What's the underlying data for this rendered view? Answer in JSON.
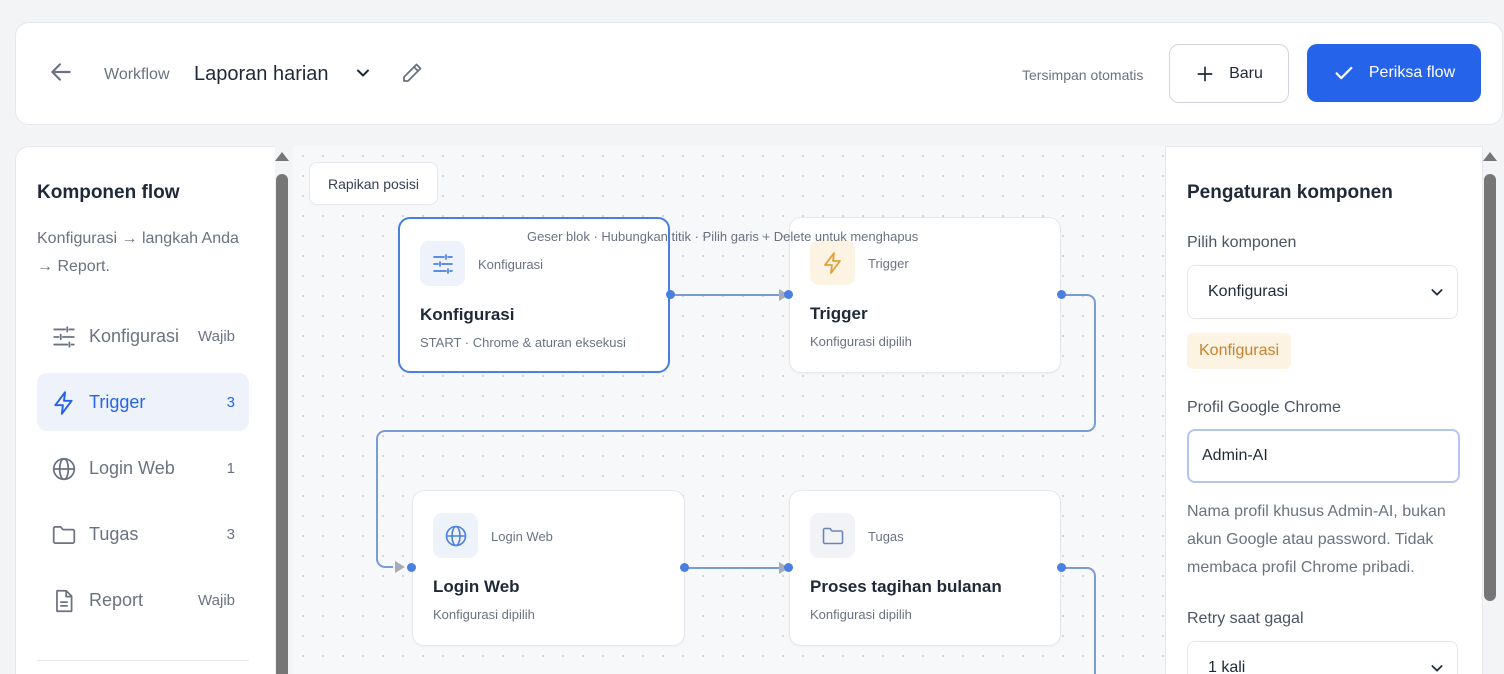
{
  "header": {
    "crumb": "Workflow",
    "title": "Laporan harian",
    "autosave": "Tersimpan otomatis",
    "new_label": "Baru",
    "check_label": "Periksa flow"
  },
  "sidebar": {
    "title": "Komponen flow",
    "description": "Konfigurasi → langkah Anda → Report.",
    "items": [
      {
        "label": "Konfigurasi",
        "badge": "Wajib",
        "icon": "sliders-icon"
      },
      {
        "label": "Trigger",
        "badge": "3",
        "icon": "lightning-icon"
      },
      {
        "label": "Login Web",
        "badge": "1",
        "icon": "globe-icon"
      },
      {
        "label": "Tugas",
        "badge": "3",
        "icon": "folder-icon"
      },
      {
        "label": "Report",
        "badge": "Wajib",
        "icon": "document-icon"
      }
    ]
  },
  "canvas": {
    "tidy_label": "Rapikan posisi",
    "hint": "Geser blok · Hubungkan titik · Pilih garis + Delete untuk menghapus",
    "nodes": [
      {
        "tag": "Konfigurasi",
        "name": "Konfigurasi",
        "sub": "START · Chrome & aturan eksekusi"
      },
      {
        "tag": "Trigger",
        "name": "Trigger",
        "sub": "Konfigurasi dipilih"
      },
      {
        "tag": "Login Web",
        "name": "Login Web",
        "sub": "Konfigurasi dipilih"
      },
      {
        "tag": "Tugas",
        "name": "Proses tagihan bulanan",
        "sub": "Konfigurasi dipilih"
      }
    ]
  },
  "settings": {
    "title": "Pengaturan komponen",
    "component_label": "Pilih komponen",
    "component_value": "Konfigurasi",
    "pill": "Konfigurasi",
    "profile_label": "Profil Google Chrome",
    "profile_value": "Admin-AI",
    "profile_help": "Nama profil khusus Admin-AI, bukan akun Google atau password. Tidak membaca profil Chrome pribadi.",
    "retry_label": "Retry saat gagal",
    "retry_value": "1 kali"
  },
  "colors": {
    "accent": "#2563eb",
    "wire": "#7b9bd6",
    "pill_bg": "#fdf3e3",
    "pill_text": "#c9822b"
  }
}
